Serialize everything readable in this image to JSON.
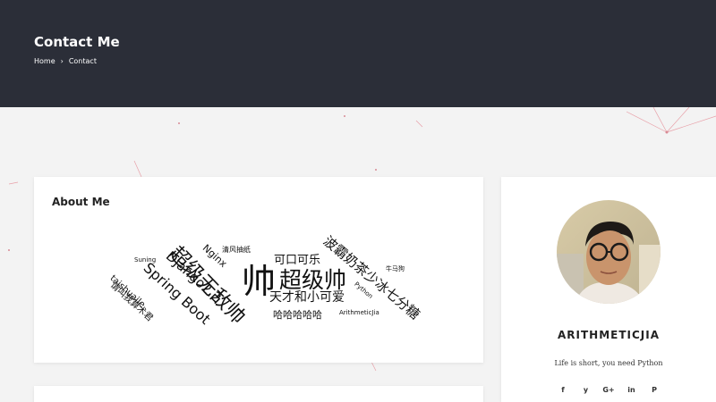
{
  "header": {
    "title": "Contact Me",
    "breadcrumb": {
      "home": "Home",
      "separator": "›",
      "current": "Contact"
    }
  },
  "about": {
    "title": "About Me",
    "word_cloud": [
      "帅",
      "超级帅",
      "超级无敌帅",
      "Spring Boot",
      "Django2.2",
      "Nginx",
      "可口可乐",
      "天才和小可爱",
      "哈哈哈哈哈",
      "波霸奶茶少冰七分糖",
      "清风抽纸",
      "Suning",
      "taishuaile",
      "请叫我算术君",
      "Python",
      "牛马狗",
      "ArithmeticJia"
    ]
  },
  "profile": {
    "name": "ARITHMETICJIA",
    "motto": "Life is short, you need Python",
    "social": [
      "f",
      "y",
      "G+",
      "in",
      "P"
    ],
    "social_icons": [
      "facebook-icon",
      "twitter-icon",
      "google-plus-icon",
      "linkedin-icon",
      "pinterest-icon"
    ]
  },
  "colors": {
    "header_bg": "#2b2e38",
    "page_bg": "#f3f3f3",
    "accent_lines": "#e8a0a8"
  }
}
